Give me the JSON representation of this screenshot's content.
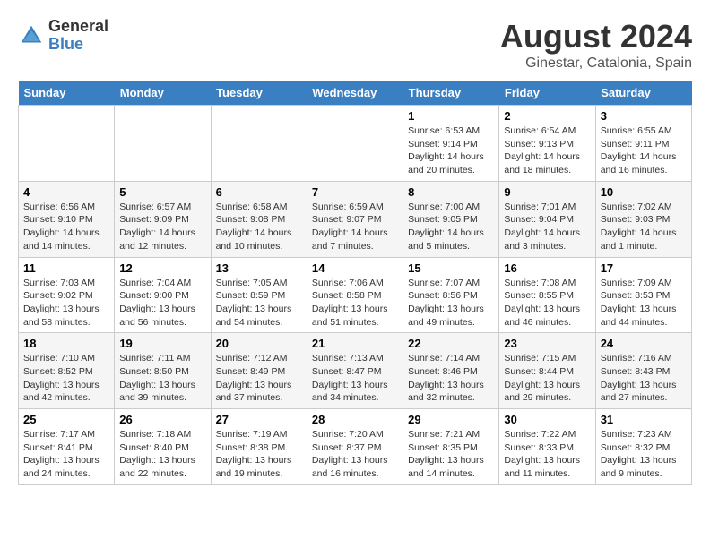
{
  "header": {
    "logo_general": "General",
    "logo_blue": "Blue",
    "main_title": "August 2024",
    "subtitle": "Ginestar, Catalonia, Spain"
  },
  "days_of_week": [
    "Sunday",
    "Monday",
    "Tuesday",
    "Wednesday",
    "Thursday",
    "Friday",
    "Saturday"
  ],
  "weeks": [
    [
      {
        "day": "",
        "info": ""
      },
      {
        "day": "",
        "info": ""
      },
      {
        "day": "",
        "info": ""
      },
      {
        "day": "",
        "info": ""
      },
      {
        "day": "1",
        "info": "Sunrise: 6:53 AM\nSunset: 9:14 PM\nDaylight: 14 hours\nand 20 minutes."
      },
      {
        "day": "2",
        "info": "Sunrise: 6:54 AM\nSunset: 9:13 PM\nDaylight: 14 hours\nand 18 minutes."
      },
      {
        "day": "3",
        "info": "Sunrise: 6:55 AM\nSunset: 9:11 PM\nDaylight: 14 hours\nand 16 minutes."
      }
    ],
    [
      {
        "day": "4",
        "info": "Sunrise: 6:56 AM\nSunset: 9:10 PM\nDaylight: 14 hours\nand 14 minutes."
      },
      {
        "day": "5",
        "info": "Sunrise: 6:57 AM\nSunset: 9:09 PM\nDaylight: 14 hours\nand 12 minutes."
      },
      {
        "day": "6",
        "info": "Sunrise: 6:58 AM\nSunset: 9:08 PM\nDaylight: 14 hours\nand 10 minutes."
      },
      {
        "day": "7",
        "info": "Sunrise: 6:59 AM\nSunset: 9:07 PM\nDaylight: 14 hours\nand 7 minutes."
      },
      {
        "day": "8",
        "info": "Sunrise: 7:00 AM\nSunset: 9:05 PM\nDaylight: 14 hours\nand 5 minutes."
      },
      {
        "day": "9",
        "info": "Sunrise: 7:01 AM\nSunset: 9:04 PM\nDaylight: 14 hours\nand 3 minutes."
      },
      {
        "day": "10",
        "info": "Sunrise: 7:02 AM\nSunset: 9:03 PM\nDaylight: 14 hours\nand 1 minute."
      }
    ],
    [
      {
        "day": "11",
        "info": "Sunrise: 7:03 AM\nSunset: 9:02 PM\nDaylight: 13 hours\nand 58 minutes."
      },
      {
        "day": "12",
        "info": "Sunrise: 7:04 AM\nSunset: 9:00 PM\nDaylight: 13 hours\nand 56 minutes."
      },
      {
        "day": "13",
        "info": "Sunrise: 7:05 AM\nSunset: 8:59 PM\nDaylight: 13 hours\nand 54 minutes."
      },
      {
        "day": "14",
        "info": "Sunrise: 7:06 AM\nSunset: 8:58 PM\nDaylight: 13 hours\nand 51 minutes."
      },
      {
        "day": "15",
        "info": "Sunrise: 7:07 AM\nSunset: 8:56 PM\nDaylight: 13 hours\nand 49 minutes."
      },
      {
        "day": "16",
        "info": "Sunrise: 7:08 AM\nSunset: 8:55 PM\nDaylight: 13 hours\nand 46 minutes."
      },
      {
        "day": "17",
        "info": "Sunrise: 7:09 AM\nSunset: 8:53 PM\nDaylight: 13 hours\nand 44 minutes."
      }
    ],
    [
      {
        "day": "18",
        "info": "Sunrise: 7:10 AM\nSunset: 8:52 PM\nDaylight: 13 hours\nand 42 minutes."
      },
      {
        "day": "19",
        "info": "Sunrise: 7:11 AM\nSunset: 8:50 PM\nDaylight: 13 hours\nand 39 minutes."
      },
      {
        "day": "20",
        "info": "Sunrise: 7:12 AM\nSunset: 8:49 PM\nDaylight: 13 hours\nand 37 minutes."
      },
      {
        "day": "21",
        "info": "Sunrise: 7:13 AM\nSunset: 8:47 PM\nDaylight: 13 hours\nand 34 minutes."
      },
      {
        "day": "22",
        "info": "Sunrise: 7:14 AM\nSunset: 8:46 PM\nDaylight: 13 hours\nand 32 minutes."
      },
      {
        "day": "23",
        "info": "Sunrise: 7:15 AM\nSunset: 8:44 PM\nDaylight: 13 hours\nand 29 minutes."
      },
      {
        "day": "24",
        "info": "Sunrise: 7:16 AM\nSunset: 8:43 PM\nDaylight: 13 hours\nand 27 minutes."
      }
    ],
    [
      {
        "day": "25",
        "info": "Sunrise: 7:17 AM\nSunset: 8:41 PM\nDaylight: 13 hours\nand 24 minutes."
      },
      {
        "day": "26",
        "info": "Sunrise: 7:18 AM\nSunset: 8:40 PM\nDaylight: 13 hours\nand 22 minutes."
      },
      {
        "day": "27",
        "info": "Sunrise: 7:19 AM\nSunset: 8:38 PM\nDaylight: 13 hours\nand 19 minutes."
      },
      {
        "day": "28",
        "info": "Sunrise: 7:20 AM\nSunset: 8:37 PM\nDaylight: 13 hours\nand 16 minutes."
      },
      {
        "day": "29",
        "info": "Sunrise: 7:21 AM\nSunset: 8:35 PM\nDaylight: 13 hours\nand 14 minutes."
      },
      {
        "day": "30",
        "info": "Sunrise: 7:22 AM\nSunset: 8:33 PM\nDaylight: 13 hours\nand 11 minutes."
      },
      {
        "day": "31",
        "info": "Sunrise: 7:23 AM\nSunset: 8:32 PM\nDaylight: 13 hours\nand 9 minutes."
      }
    ]
  ]
}
